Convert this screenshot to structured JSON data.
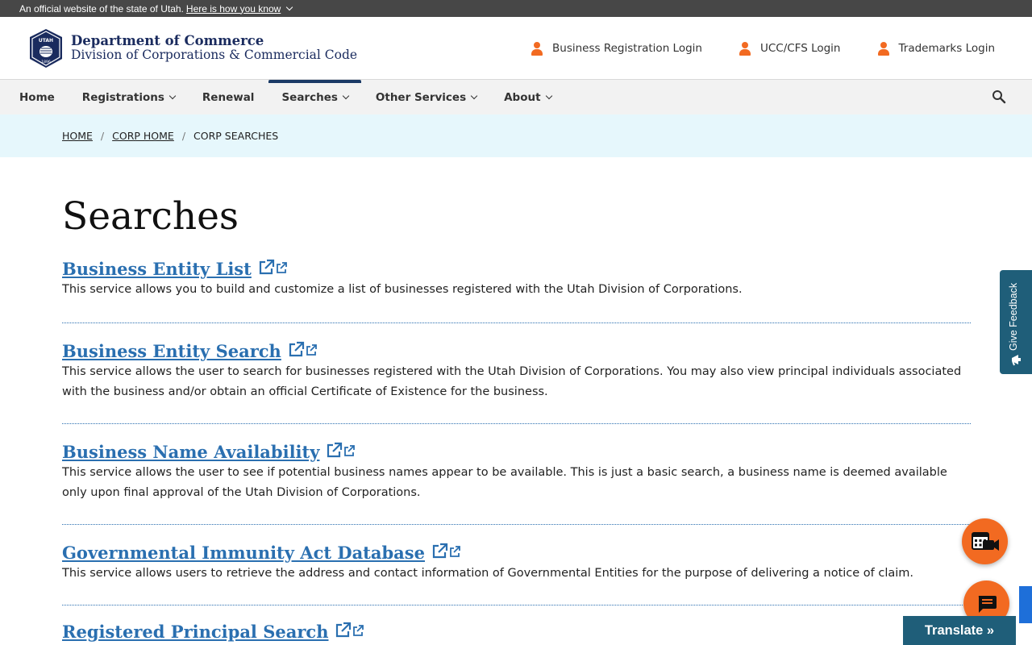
{
  "gov_bar": {
    "text": "An official website of the state of Utah.",
    "link": "Here is how you know"
  },
  "header": {
    "seal_text": "UTAH",
    "seal_year": "1896",
    "dept_name": "Department of Commerce",
    "division_name": "Division of Corporations & Commercial Code",
    "logins": [
      {
        "label": "Business Registration Login",
        "icon": "person-icon"
      },
      {
        "label": "UCC/CFS Login",
        "icon": "person-icon"
      },
      {
        "label": "Trademarks Login",
        "icon": "person-icon"
      }
    ]
  },
  "nav": {
    "items": [
      {
        "label": "Home",
        "dropdown": false
      },
      {
        "label": "Registrations",
        "dropdown": true
      },
      {
        "label": "Renewal",
        "dropdown": false
      },
      {
        "label": "Searches",
        "dropdown": true,
        "active": true
      },
      {
        "label": "Other Services",
        "dropdown": true
      },
      {
        "label": "About",
        "dropdown": true
      }
    ],
    "search_icon": "search-icon"
  },
  "breadcrumb": [
    {
      "label": "HOME",
      "link": true
    },
    {
      "label": "CORP HOME",
      "link": true
    },
    {
      "label": "CORP SEARCHES",
      "link": false
    }
  ],
  "page_title": "Searches",
  "services": [
    {
      "title": "Business Entity List",
      "description": "This service allows you to build and customize a list of businesses registered with the Utah Division of Corporations."
    },
    {
      "title": "Business Entity Search",
      "description": "This service allows the user to search for businesses registered with the Utah Division of Corporations. You may also view principal individuals associated with the business and/or obtain an official Certificate of Existence for the business."
    },
    {
      "title": "Business Name Availability",
      "description": "This service allows the user to see if potential business names appear to be available. This is just a basic search, a business name is deemed available only upon final approval of the Utah Division of Corporations."
    },
    {
      "title": "Governmental Immunity Act Database",
      "description": "This service allows users to retrieve the address and contact information of Governmental Entities for the purpose of delivering a notice of claim."
    },
    {
      "title": "Registered Principal Search",
      "description": ""
    }
  ],
  "widgets": {
    "feedback": "Give Feedback",
    "translate": "Translate »"
  },
  "colors": {
    "accent_orange": "#f26a21",
    "link_blue": "#2a6fb0",
    "navy": "#1a2b5e",
    "teal": "#1f5e79",
    "crumb_bg": "#e6f7fc"
  }
}
